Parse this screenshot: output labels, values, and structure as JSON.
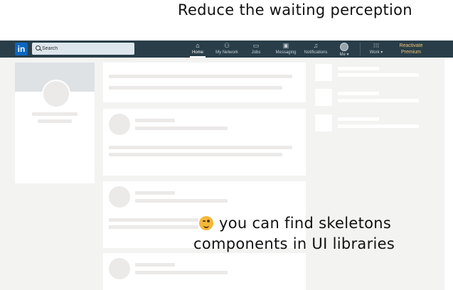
{
  "captions": {
    "top": "Reduce the waiting perception",
    "bottom_line1": "you can find skeletons",
    "bottom_line2": "components in UI libraries"
  },
  "navbar": {
    "logo_text": "in",
    "search": {
      "placeholder": "Search"
    },
    "items": [
      {
        "label": "Home",
        "icon": "home-icon",
        "active": true
      },
      {
        "label": "My Network",
        "icon": "network-icon",
        "active": false
      },
      {
        "label": "Jobs",
        "icon": "briefcase-icon",
        "active": false
      },
      {
        "label": "Messaging",
        "icon": "messaging-icon",
        "active": false
      },
      {
        "label": "Notifications",
        "icon": "bell-icon",
        "active": false
      },
      {
        "label": "Me ▾",
        "icon": "avatar",
        "active": false
      },
      {
        "label": "Work ▾",
        "icon": "grid-icon",
        "active": false
      }
    ],
    "premium_line1": "Reactivate",
    "premium_line2": "Premium"
  },
  "colors": {
    "navbar": "#293e49",
    "page_background": "#f3f3f2",
    "skeleton": "#eceae8",
    "premium": "#f0c46e"
  }
}
